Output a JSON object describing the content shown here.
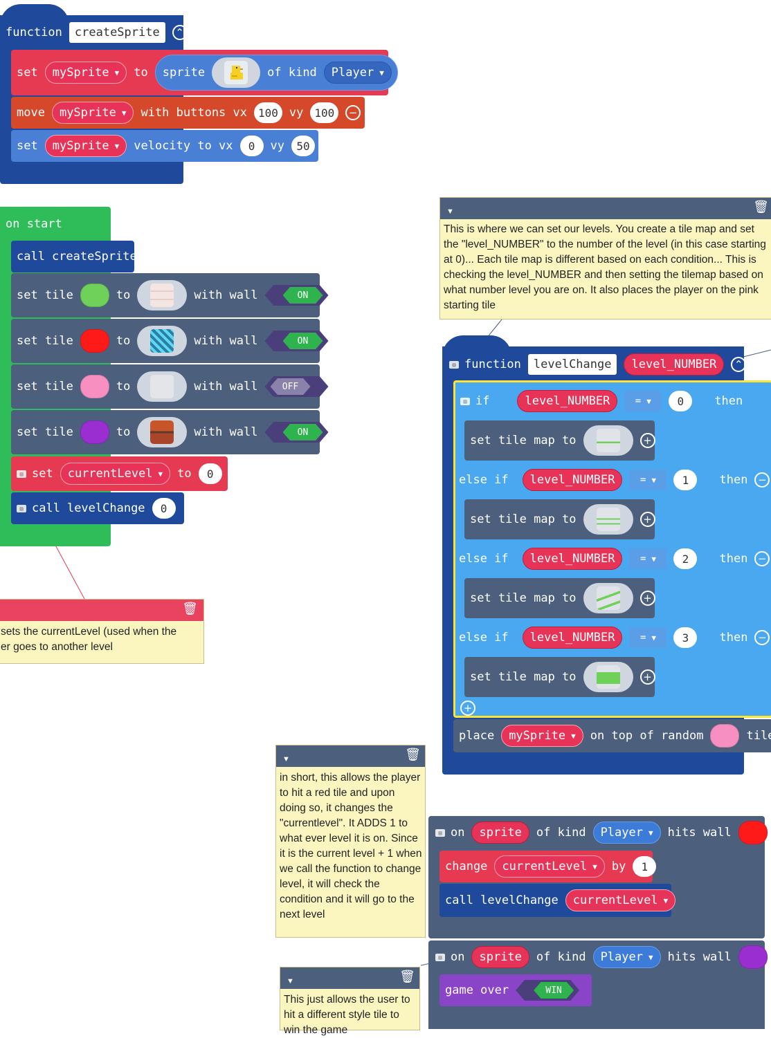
{
  "create_sprite": {
    "function_kw": "function",
    "name": "createSprite",
    "set_kw": "set",
    "var": "mySprite",
    "to_kw": "to",
    "sprite_kw": "sprite",
    "of_kind_kw": "of kind",
    "kind": "Player",
    "move_kw": "move",
    "with_buttons_kw": "with buttons vx",
    "vx": "100",
    "vy_kw": "vy",
    "vy": "100",
    "velocity_kw": "velocity to vx",
    "vel_vx": "0",
    "vel_vy": "50"
  },
  "on_start": {
    "label": "on start",
    "call_kw": "call",
    "call_fn": "createSprite",
    "tile_rows": [
      {
        "color": "#6fd15a",
        "tile": "brick",
        "wall": "ON"
      },
      {
        "color": "#ff1a1a",
        "tile": "cyan-pattern",
        "wall": "ON"
      },
      {
        "color": "#f78fc0",
        "tile": "blank",
        "wall": "OFF"
      },
      {
        "color": "#9a2ed1",
        "tile": "chest",
        "wall": "ON"
      }
    ],
    "set_tile_kw": "set tile",
    "to_kw": "to",
    "with_wall_kw": "with wall",
    "set_kw": "set",
    "current_var": "currentLevel",
    "current_val": "0",
    "call_level_fn": "levelChange",
    "call_level_arg": "0"
  },
  "note_start": {
    "line1": "sets the currentLevel (used when the",
    "line2": "er goes to another level"
  },
  "note_levels": {
    "text": "This is where we can set our levels.  You create a tile map and set the \"level_NUMBER\" to the number of the level (in this case starting at 0)... Each tile map is different based on each condition... This is checking the level_NUMBER and then setting the tilemap based on what number level you are on.  It also places the player on the pink starting tile"
  },
  "level_change": {
    "function_kw": "function",
    "name": "levelChange",
    "param": "level_NUMBER",
    "if_kw": "if",
    "else_if_kw": "else if",
    "op": "=",
    "then_kw": "then",
    "set_map_kw": "set tile map to",
    "branches": [
      "0",
      "1",
      "2",
      "3"
    ],
    "place_kw": "place",
    "place_var": "mySprite",
    "on_top_kw": "on top of random",
    "tile_kw": "tile"
  },
  "note_short": {
    "text": "in short, this allows the player to hit a red tile and upon doing so, it changes the \"currentlevel\".  It ADDS 1 to what ever level it is on. Since it is the current level + 1 when we call the function to change level, it will check the condition and it will go to the next level"
  },
  "hit_red": {
    "on_kw": "on",
    "sprite_kw": "sprite",
    "of_kind_kw": "of kind",
    "kind": "Player",
    "hits_wall_kw": "hits wall",
    "change_kw": "change",
    "var": "currentLevel",
    "by_kw": "by",
    "by_val": "1",
    "call_kw": "call levelChange",
    "call_arg": "currentLevel"
  },
  "hit_purple": {
    "on_kw": "on",
    "sprite_kw": "sprite",
    "of_kind_kw": "of kind",
    "kind": "Player",
    "hits_wall_kw": "hits wall",
    "game_over_kw": "game over",
    "result": "WIN"
  },
  "note_win": {
    "line1": "This just allows the user to",
    "line2": "hit a different style tile to",
    "line3": "win the game"
  },
  "colors": {
    "function_blue": "#1f4a9c",
    "set_red": "#e53a52",
    "move_orange": "#d5482a",
    "sprite_blue": "#4a7fd6",
    "on_start_green": "#2ebd59",
    "tile_gray": "#4c5f7d",
    "logic_blue": "#4aa8f0",
    "highlight_yellow": "#ffe531",
    "game_purple": "#8a44c7"
  }
}
